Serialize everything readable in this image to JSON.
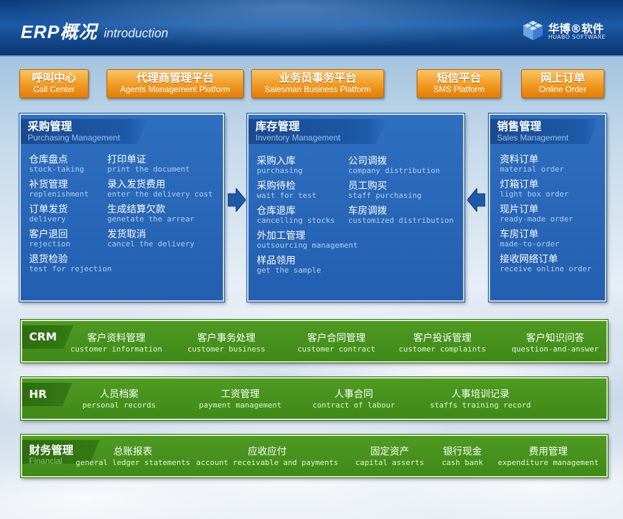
{
  "header": {
    "title_cn": "ERP概况",
    "title_en": "introduction",
    "brand_cn": "华博®软件",
    "brand_en": "HUABO SOFTWARE"
  },
  "platforms": [
    {
      "cn": "呼叫中心",
      "en": "Call Center"
    },
    {
      "cn": "代理商管理平台",
      "en": "Agents Management Platform"
    },
    {
      "cn": "业务员事务平台",
      "en": "Salesman Business Platform"
    },
    {
      "cn": "短信平台",
      "en": "SMS Platform"
    },
    {
      "cn": "网上订单",
      "en": "Online Order"
    }
  ],
  "purchasing": {
    "title_cn": "采购管理",
    "title_en": "Purchasing Management",
    "items": [
      {
        "cn": "仓库盘点",
        "en": "stock-taking"
      },
      {
        "cn": "打印单证",
        "en": "print the document"
      },
      {
        "cn": "补货管理",
        "en": "replenishment"
      },
      {
        "cn": "录入发货费用",
        "en": "enter the delivery cost"
      },
      {
        "cn": "订单发货",
        "en": "delivery"
      },
      {
        "cn": "生成结算欠款",
        "en": "genetate the arrear"
      },
      {
        "cn": "客户退回",
        "en": "rejection"
      },
      {
        "cn": "发货取消",
        "en": "cancel the delivery"
      },
      {
        "cn": "退货检验",
        "en": "test for rejection"
      }
    ]
  },
  "inventory": {
    "title_cn": "库存管理",
    "title_en": "Inventory Management",
    "items": [
      {
        "cn": "采购入库",
        "en": "purchasing"
      },
      {
        "cn": "公司调拨",
        "en": "company distribution"
      },
      {
        "cn": "采购待检",
        "en": "wait for test"
      },
      {
        "cn": "员工购买",
        "en": "staff purchasing"
      },
      {
        "cn": "仓库退库",
        "en": "cancelling stocks"
      },
      {
        "cn": "车房调拨",
        "en": "customized distribution"
      },
      {
        "cn": "外加工管理",
        "en": "outsourcing management"
      },
      {
        "cn": "样品领用",
        "en": "get the sample"
      }
    ]
  },
  "sales": {
    "title_cn": "销售管理",
    "title_en": "Sales Management",
    "items": [
      {
        "cn": "资料订单",
        "en": "material order"
      },
      {
        "cn": "灯箱订单",
        "en": "light box order"
      },
      {
        "cn": "现片订单",
        "en": "ready-made order"
      },
      {
        "cn": "车房订单",
        "en": "made-to-order"
      },
      {
        "cn": "接收网络订单",
        "en": "receive online order"
      }
    ]
  },
  "crm": {
    "tag_cn": "CRM",
    "items": [
      {
        "cn": "客户资料管理",
        "en": "customer information"
      },
      {
        "cn": "客户事务处理",
        "en": "customer business"
      },
      {
        "cn": "客户合同管理",
        "en": "customer contract"
      },
      {
        "cn": "客户投诉管理",
        "en": "customer complaints"
      },
      {
        "cn": "客户知识问答",
        "en": "question-and-answer"
      }
    ]
  },
  "hr": {
    "tag_cn": "HR",
    "items": [
      {
        "cn": "人员档案",
        "en": "personal records"
      },
      {
        "cn": "工资管理",
        "en": "payment management"
      },
      {
        "cn": "人事合同",
        "en": "contract of labour"
      },
      {
        "cn": "人事培训记录",
        "en": "staffs training record"
      }
    ]
  },
  "finance": {
    "tag_cn": "财务管理",
    "tag_en": "Financial",
    "items": [
      {
        "cn": "总账报表",
        "en": "general ledger statements"
      },
      {
        "cn": "应收应付",
        "en": "account receivable and payments"
      },
      {
        "cn": "固定资产",
        "en": "capital asserts"
      },
      {
        "cn": "银行现金",
        "en": "cash bank"
      },
      {
        "cn": "费用管理",
        "en": "expenditure management"
      }
    ]
  },
  "colors": {
    "header_blue": "#1c5aa6",
    "panel_blue": "#2f6fc0",
    "button_orange": "#f19a22",
    "bar_green": "#4f9a22"
  }
}
